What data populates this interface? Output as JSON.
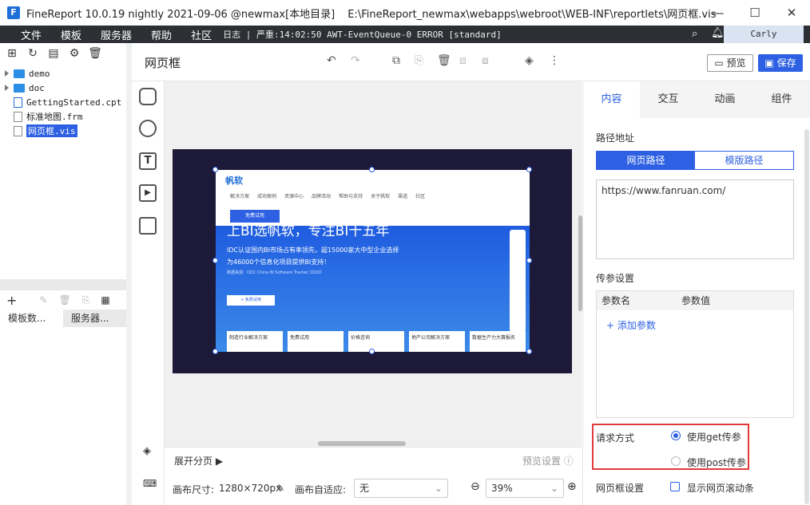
{
  "window": {
    "title": "FineReport 10.0.19 nightly 2021-09-06 @newmax[本地目录]",
    "path": "E:\\FineReport_newmax\\webapps\\webroot\\WEB-INF\\reportlets\\网页框.vis",
    "logo_letter": "F"
  },
  "menu": {
    "items": [
      "文件",
      "模板",
      "服务器",
      "帮助",
      "社区"
    ],
    "log": "日志 | 严重:14:02:50 AWT-EventQueue-0 ERROR [standard]",
    "user": "Carly"
  },
  "tree": {
    "items": [
      {
        "label": "demo",
        "type": "folder"
      },
      {
        "label": "doc",
        "type": "folder"
      },
      {
        "label": "GettingStarted.cpt",
        "type": "file"
      },
      {
        "label": "标准地图.frm",
        "type": "file"
      },
      {
        "label": "网页框.vis",
        "type": "file",
        "selected": true
      }
    ],
    "tabs": [
      "模板数...",
      "服务器..."
    ]
  },
  "toolbar": {
    "page_name": "网页框",
    "preview_label": "预览",
    "save_label": "保存"
  },
  "webframe": {
    "brand": "帆软",
    "nav": [
      "解决方案",
      "成功案例",
      "资源中心",
      "品牌活动",
      "帮助与支持",
      "关于帆软",
      "渠道",
      "社区"
    ],
    "button": "免费试用",
    "hero_title": "上BI选帆软，专注BI十五年",
    "hero_p1": "IDC认证国内BI市场占有率领先，超15000家大中型企业选择",
    "hero_p2": "为46000个信息化项目提供BI支持！",
    "hero_p3": "数据来源：《IDC China BI Software Tracker 2020》",
    "trial": "+ 免费试用",
    "cards": [
      "制造行业解决方案",
      "免费试用",
      "价格咨询",
      "地产公司解决方案",
      "数据生产力大赛报名"
    ]
  },
  "pagebar": {
    "expand_label": "展开分页",
    "preview_setting": "预览设置"
  },
  "status": {
    "canvas_size_label": "画布尺寸:",
    "canvas_size": "1280×720px",
    "adapt_label": "画布自适应:",
    "adapt_value": "无",
    "zoom": "39%"
  },
  "rpanel": {
    "tabs": [
      "内容",
      "交互",
      "动画",
      "组件"
    ],
    "url_section": "路径地址",
    "seg_web": "网页路径",
    "seg_template": "模版路径",
    "url": "https://www.fanruan.com/",
    "param_section": "传参设置",
    "param_name": "参数名",
    "param_value": "参数值",
    "add_param": "+ 添加参数",
    "request_label": "请求方式",
    "get_label": "使用get传参",
    "post_label": "使用post传参",
    "frame_label": "网页框设置",
    "scroll_label": "显示网页滚动条"
  },
  "colors": {
    "accent": "#2d60e2",
    "menubar": "#2c2f33",
    "board": "#1c1a38",
    "highlight_box": "#e03a3a"
  }
}
